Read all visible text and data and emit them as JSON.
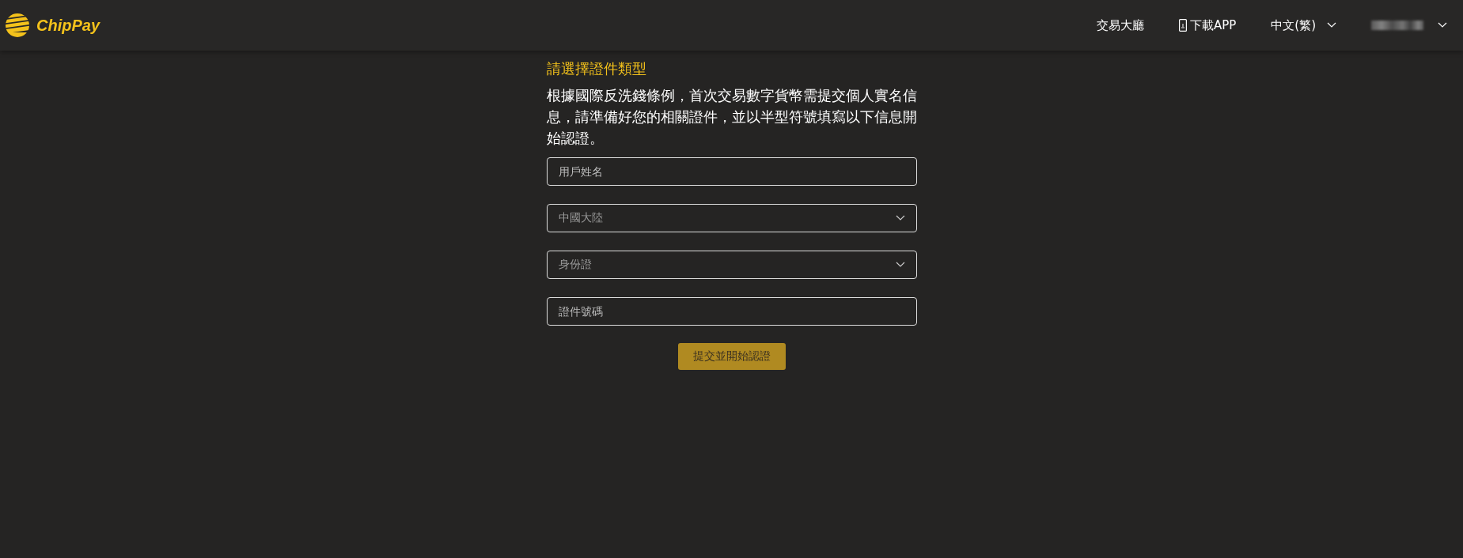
{
  "header": {
    "logo": "ChipPay",
    "nav": [
      {
        "kind": "link",
        "label": "交易大廳"
      },
      {
        "kind": "app",
        "label": "下載APP"
      },
      {
        "kind": "dropdown",
        "label": "中文(繁)"
      },
      {
        "kind": "account"
      }
    ]
  },
  "form": {
    "title": "請選擇證件類型",
    "description": "根據國際反洗錢條例，首次交易數字貨幣需提交個人實名信息，請準備好您的相關證件，並以半型符號填寫以下信息開始認證。",
    "fields": [
      {
        "kind": "input",
        "placeholder": "用戶姓名"
      },
      {
        "kind": "select",
        "value": "中國大陸"
      },
      {
        "kind": "select",
        "value": "身份證"
      },
      {
        "kind": "input",
        "placeholder": "證件號碼"
      }
    ],
    "submit": "提交並開始認證"
  }
}
